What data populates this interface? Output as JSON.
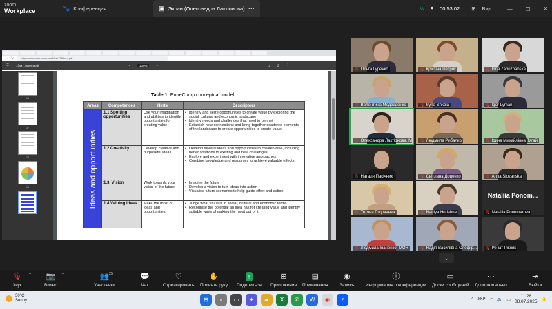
{
  "topbar": {
    "logo_top": "zoom",
    "logo_bottom": "Workplace",
    "tabs": [
      {
        "label": "Конференция",
        "icon": "paw-icon"
      },
      {
        "label": "Экран (Олександра Лактіонова)",
        "icon": "screen-share-icon"
      }
    ],
    "timer": "00:53:02",
    "view_label": "Вид"
  },
  "pdf": {
    "url": "edp.europa.eu/resources/1ftsx7755em.pdf",
    "filename": "1ftsx7755em.pdf",
    "zoom": "100%",
    "thumb_numbers": [
      "16",
      "17",
      "18",
      "19"
    ],
    "table_title_bold": "Table 1:",
    "table_title_rest": " EntreComp conceptual model",
    "headers": [
      "Areas",
      "Competences",
      "Hints",
      "Descriptors"
    ],
    "area": "Ideas and opportunities",
    "rows": [
      {
        "comp": "1.1 Spotting opportunities",
        "hint": "Use your imagination and abilities to identify opportunities for creating value",
        "desc": [
          "Identify and seize opportunities to create value by exploring the social, cultural and economic landscape",
          "Identify needs and challenges that need to be met",
          "Establish new connections and bring together scattered elements of the landscape to create opportunities to create value"
        ]
      },
      {
        "comp": "1.2 Creativity",
        "hint": "Develop creative and purposeful ideas",
        "desc": [
          "Develop several ideas and opportunities to create value, including better solutions to existing and new challenges",
          "Explore and experiment with innovative approaches",
          "Combine knowledge and resources to achieve valuable effects"
        ]
      },
      {
        "comp": "1.3. Vision",
        "hint": "Work towards your vision of the future",
        "desc": [
          "Imagine the future",
          "Develop a vision to turn ideas into action",
          "Visualise future scenarios to help guide effort and action"
        ]
      },
      {
        "comp": "1.4 Valuing ideas",
        "hint": "Make the most of ideas and opportunities",
        "desc": [
          "Judge what value is in social, cultural and economic terms",
          "Recognise the potential an idea has for creating value and identify suitable ways of making the most out of it"
        ]
      }
    ]
  },
  "participants": [
    {
      "name": "Ольга Гуренко",
      "bg": "#8a7a6a",
      "hair": "#6b4a2e",
      "body": "#2b2b3b"
    },
    {
      "name": "Крістіна Петрик",
      "bg": "#c4b08a",
      "hair": "#7a4a2a",
      "body": "#d6d0c8"
    },
    {
      "name": "Inna Zabuzhanska",
      "bg": "#d8d8d8",
      "hair": "#3a2a1e",
      "body": "#2a2a2a"
    },
    {
      "name": "Валентина Медведенко",
      "bg": "#b8b4a8",
      "hair": "#c9a46a",
      "body": "#8ab0d0"
    },
    {
      "name": "Iryna Shkola",
      "bg": "#a8624a",
      "hair": "#5a3a28",
      "body": "#4a4a7a"
    },
    {
      "name": "Igor Lyman",
      "bg": "#9a9a9a",
      "hair": "#3a3a3a",
      "body": "#2a2a3a"
    },
    {
      "name": "Олександра Лактіонова, М...",
      "bg": "#d8d4cc",
      "hair": "#2e2218",
      "body": "#1e2e3e"
    },
    {
      "name": "Людмила Рибалко",
      "bg": "#c8a070",
      "hair": "#4a3020",
      "body": "#7a6a5a"
    },
    {
      "name": "Ірина Михайлівна Тягай",
      "bg": "#a8c8a0",
      "hair": "#d0b080",
      "body": "#3a3a3a"
    },
    {
      "name": "Наталя Пасічник",
      "bg": "#2a2a2a",
      "hair": "#3a2618",
      "body": "#1a1a1a"
    },
    {
      "name": "Світлана Доценко",
      "bg": "#c0b8a8",
      "hair": "#d4a860",
      "body": "#7a5a8a"
    },
    {
      "name": "Anna Slozanska",
      "bg": "#b0a090",
      "hair": "#3a2a1a",
      "body": "#2a2a2a"
    },
    {
      "name": "Тетяна Годованюк",
      "bg": "#d8c8a8",
      "hair": "#d8b070",
      "body": "#c0a080"
    },
    {
      "name": "Nadiya Horishna",
      "bg": "#d8d0c0",
      "hair": "#4a3a2a",
      "body": "#3a3a4a"
    },
    {
      "name": "Nataliia Ponomarova",
      "bg": "#2a2a2a",
      "hair": "#2a2a2a",
      "body": "#2a2a2a",
      "big": "Nataliia  Ponom..."
    },
    {
      "name": "Людмила Іваненко, МОН",
      "bg": "#a8b8d0",
      "hair": "#c09060",
      "body": "#c04040"
    },
    {
      "name": "Надія Василівна Олефір...",
      "bg": "#a0a8b8",
      "hair": "#8a5a3a",
      "body": "#2a2a2a"
    },
    {
      "name": "Ренат Ржняк",
      "bg": "#3a3a3a",
      "hair": "#2a2a2a",
      "body": "#1a1a1a"
    }
  ],
  "toolbar": {
    "audio": "Звук",
    "video": "Видео",
    "participants": "Участники",
    "participants_count": "25",
    "chat": "Чат",
    "react": "Отреагировать",
    "raise_hand": "Поднять руку",
    "share": "Поделиться",
    "apps": "Приложения",
    "notes": "Примечания",
    "record": "Запись",
    "info": "Информация о конференции",
    "whiteboard": "Доски сообщений",
    "more": "Дополнительно",
    "leave": "Выйти"
  },
  "taskbar": {
    "temp": "30°C",
    "weather": "Sunny",
    "lang": "УКР",
    "time": "11:28",
    "date": "08.07.2025"
  }
}
